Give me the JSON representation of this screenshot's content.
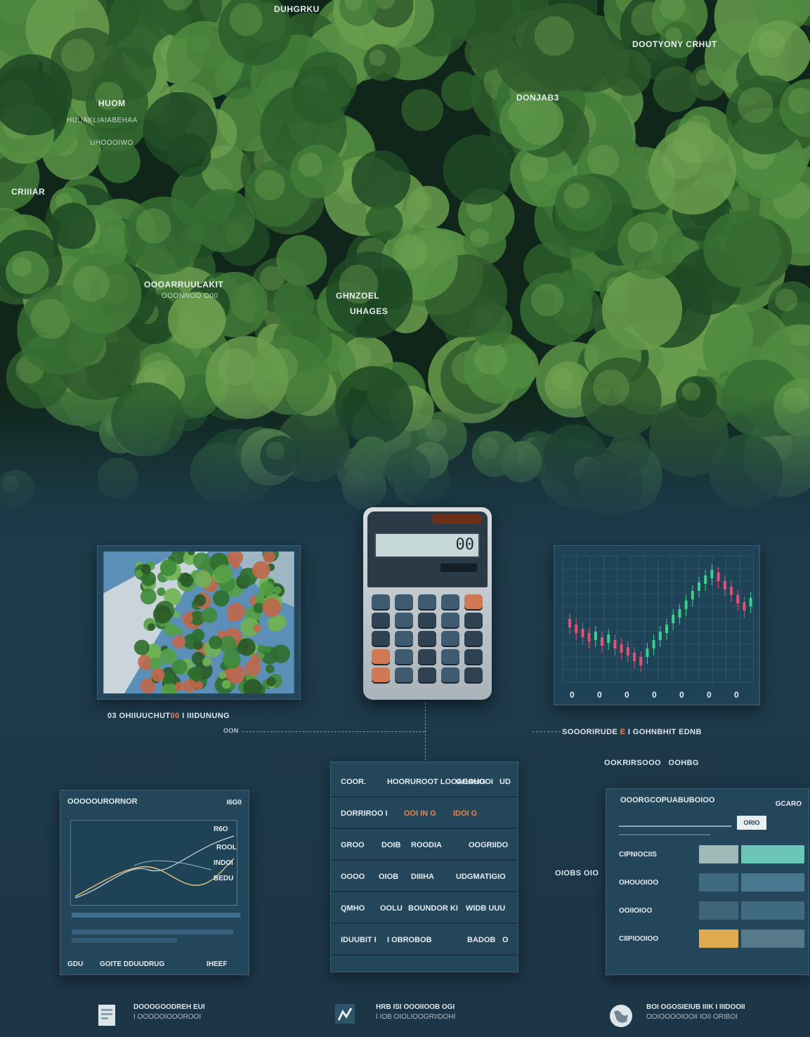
{
  "forest_labels": {
    "top_center": "DUHGRKU",
    "top_right": "DOOTYONY CRHUT",
    "right_mid": "DONJAB3",
    "left_1": "HUOM",
    "left_2": "HUUAKLIAIABEHAA",
    "left_3": "UHOOOIWO",
    "far_left": "CRIIIAR",
    "lower_left": "OOOARRUULAKIT",
    "lower_left_sub": "OOONNOO O00",
    "center_1": "GHNZOEL",
    "center_2": "UHAGES"
  },
  "calculator": {
    "display": "00"
  },
  "chart": {
    "x_ticks": [
      "0",
      "0",
      "0",
      "0",
      "0",
      "0",
      "0"
    ]
  },
  "captions": {
    "photo_a": "03 OHIIUUCHUT",
    "photo_b": "00",
    "photo_c": "I IIIDUNUNG",
    "dash_left": "OON",
    "chart_a": "SOOORIRUDE",
    "chart_b": "E",
    "chart_c": "I GOHNBHIT EDNB",
    "chart_sub_a": "OOKRIRSOOO",
    "chart_sub_b": "OOHBG"
  },
  "card_left": {
    "title": "OOOOOURORNOR",
    "badge": "I6G0",
    "legend": [
      "R6O",
      "ROOL",
      "INDOI",
      "BEDU"
    ],
    "footer_a": "GDU",
    "footer_b": "GOITE DDUUDRUG",
    "footer_c": "IHEEF"
  },
  "card_center": {
    "rows": [
      [
        "COOR.",
        "HOORUROOT LOOAEAUOOI",
        "OOOHG",
        "UD"
      ],
      [
        "DORRIROO I",
        "OOI IN G",
        "IDOI G",
        ""
      ],
      [
        "GROO",
        "DOIB",
        "ROODIA",
        "OOGRIIDO"
      ],
      [
        "OOOO",
        "OIOB",
        "DIIIHA",
        "UDGMATIGIO"
      ],
      [
        "QMHO",
        "OOLU",
        "BOUNDOR KI",
        "WIDB UUU"
      ],
      [
        "IDUUBIT I",
        "I OBROBOB",
        "BADOB",
        "O"
      ]
    ]
  },
  "card_right": {
    "title": "OOORGCOPUABUBOIOO",
    "badge": "GCARO",
    "slider_value": "ORIO",
    "side_label": "OIOBS OIO",
    "settings": [
      "CIPNIOCIIS",
      "OHOUOIOO",
      "OOIIOIOO",
      "CIIPIOOIOO"
    ],
    "swatches": [
      "#9fb9b6",
      "#6cc6b8",
      "#3f6a80",
      "#4a7790",
      "#3d6779",
      "#3f6a80",
      "#e0aa4e",
      "#577a8a"
    ]
  },
  "footer": {
    "item1_a": "DOOOGOODREH EUI",
    "item1_b": "I OOOOOIOOOROOI",
    "item2_a": "HRB ISI OOOIIOOB OGI",
    "item2_b": "I IOB OIOLIOOGRIIDOHI",
    "item3_a": "BOI OGOSIEIUB IIIK I IIIDOOII",
    "item3_b": "OOIOOOOIOOII IOII ORIBOI"
  }
}
